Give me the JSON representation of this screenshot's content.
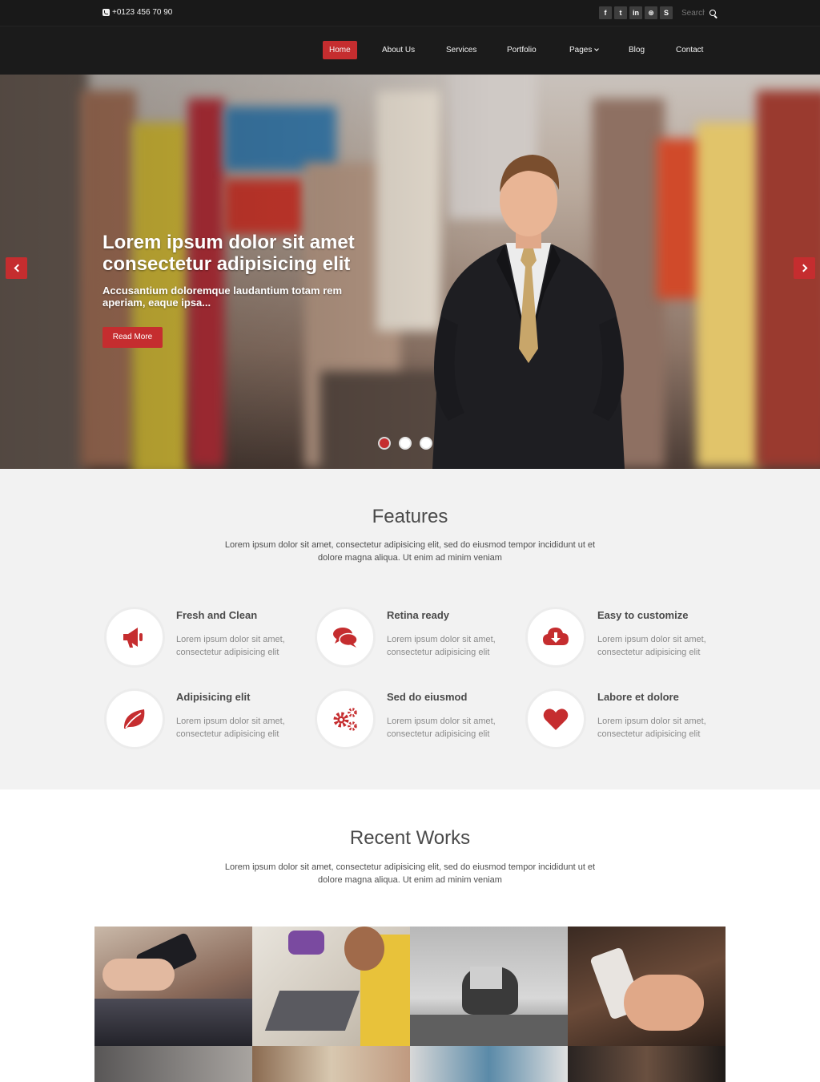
{
  "topbar": {
    "phone": "+0123 456 70 90",
    "social": [
      {
        "icon": "facebook-icon",
        "glyph": "f"
      },
      {
        "icon": "twitter-icon",
        "glyph": "t"
      },
      {
        "icon": "linkedin-icon",
        "glyph": "in"
      },
      {
        "icon": "dribbble-icon",
        "glyph": "⊛"
      },
      {
        "icon": "skype-icon",
        "glyph": "S"
      }
    ],
    "search_placeholder": "Search"
  },
  "nav": {
    "items": [
      "Home",
      "About Us",
      "Services",
      "Portfolio",
      "Pages",
      "Blog",
      "Contact"
    ],
    "active": "Home"
  },
  "hero": {
    "title": "Lorem ipsum dolor sit amet consectetur adipisicing elit",
    "subtitle": "Accusantium doloremque laudantium totam rem aperiam, eaque ipsa...",
    "button": "Read More",
    "slide_count": 3,
    "active_slide": 1
  },
  "features": {
    "title": "Features",
    "description": "Lorem ipsum dolor sit amet, consectetur adipisicing elit, sed do eiusmod tempor incididunt ut et dolore magna aliqua. Ut enim ad minim veniam",
    "items": [
      {
        "title": "Fresh and Clean",
        "text": "Lorem ipsum dolor sit amet, consectetur adipisicing elit",
        "icon": "bullhorn-icon"
      },
      {
        "title": "Retina ready",
        "text": "Lorem ipsum dolor sit amet, consectetur adipisicing elit",
        "icon": "comments-icon"
      },
      {
        "title": "Easy to customize",
        "text": "Lorem ipsum dolor sit amet, consectetur adipisicing elit",
        "icon": "cloud-download-icon"
      },
      {
        "title": "Adipisicing elit",
        "text": "Lorem ipsum dolor sit amet, consectetur adipisicing elit",
        "icon": "leaf-icon"
      },
      {
        "title": "Sed do eiusmod",
        "text": "Lorem ipsum dolor sit amet, consectetur adipisicing elit",
        "icon": "cogs-icon"
      },
      {
        "title": "Labore et dolore",
        "text": "Lorem ipsum dolor sit amet, consectetur adipisicing elit",
        "icon": "heart-icon"
      }
    ]
  },
  "works": {
    "title": "Recent Works",
    "description": "Lorem ipsum dolor sit amet, consectetur adipisicing elit, sed do eiusmod tempor incididunt ut et dolore magna aliqua. Ut enim ad minim veniam"
  },
  "colors": {
    "accent": "#c52d2f",
    "topbar": "#191919",
    "navbar": "#1b1b1b",
    "features_bg": "#f2f2f2"
  }
}
